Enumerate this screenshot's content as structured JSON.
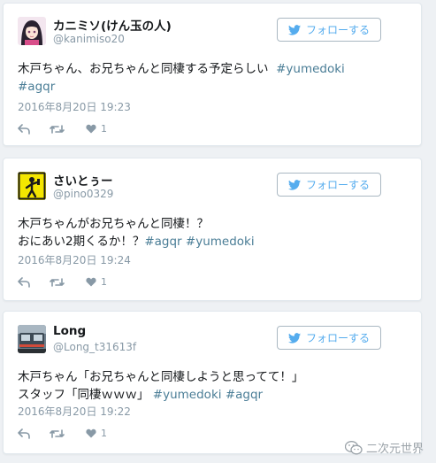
{
  "tweets": [
    {
      "display_name": "カニミソ(けん玉の人)",
      "handle": "@kanimiso20",
      "follow_label": "フォローする",
      "text_plain": "木戸ちゃん、お兄ちゃんと同棲する予定らしい",
      "hashtags": [
        "#yumedoki",
        "#agqr"
      ],
      "timestamp": "2016年8月20日 19:23",
      "like_count": "1",
      "avatar_icon": "anime-girl-avatar-icon"
    },
    {
      "display_name": "さいとぅー",
      "handle": "@pino0329",
      "follow_label": "フォローする",
      "text_line1": "木戸ちゃんがお兄ちゃんと同棲！？",
      "text_line2_plain": "おにあい2期くるか！？",
      "hashtags": [
        "#agqr",
        "#yumedoki"
      ],
      "timestamp": "2016年8月20日 19:24",
      "like_count": "1",
      "avatar_icon": "yellow-figure-avatar-icon"
    },
    {
      "display_name": "Long",
      "handle": "@Long_t31613f",
      "follow_label": "フォローする",
      "text_line1": "木戸ちゃん「お兄ちゃんと同棲しようと思ってて！」",
      "text_line2_plain": "スタッフ「同棲ｗｗｗ」",
      "hashtags": [
        "#yumedoki",
        "#agqr"
      ],
      "timestamp": "2016年8月20日 19:22",
      "like_count": "1",
      "avatar_icon": "train-photo-avatar-icon"
    }
  ],
  "watermark": {
    "text": "二次元世界",
    "icon": "wechat-icon"
  },
  "colors": {
    "background": "#eef1f4",
    "card": "#ffffff",
    "accent": "#55acee",
    "hashtag": "#4a7d96",
    "muted": "#8899a6"
  }
}
